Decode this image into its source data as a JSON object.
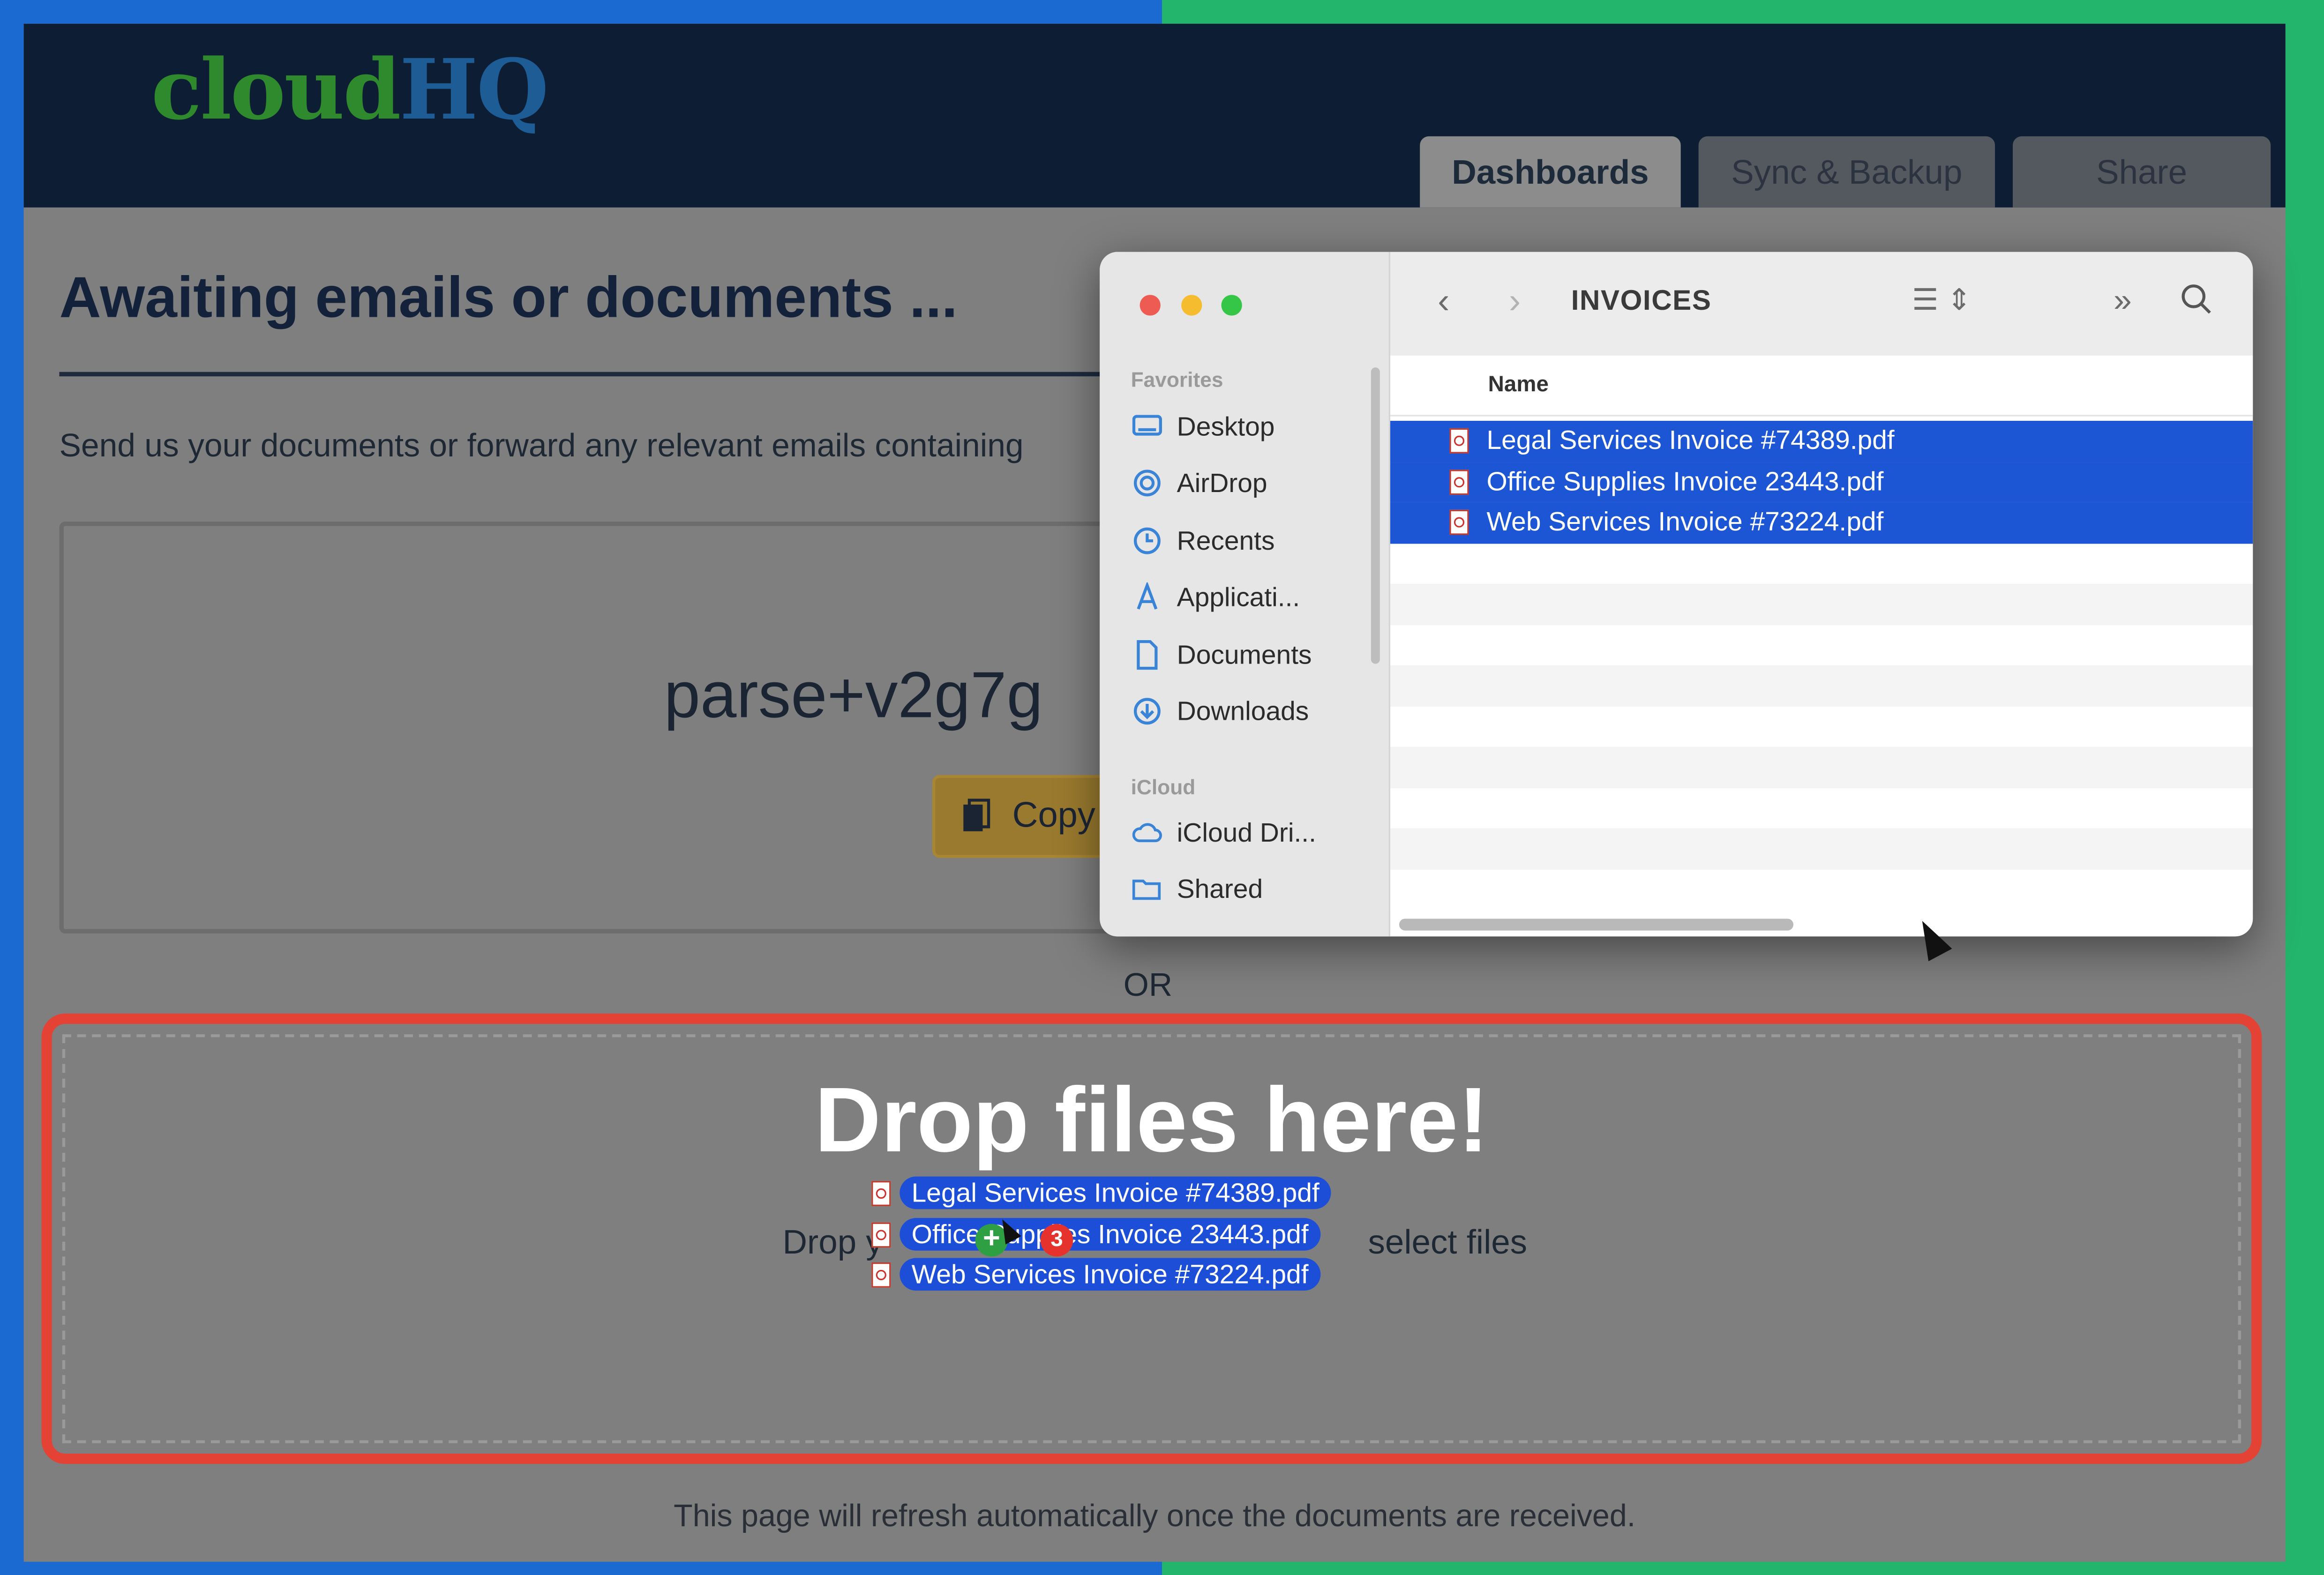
{
  "app": {
    "logo_part1": "cloud",
    "logo_part2": "HQ",
    "tabs": [
      {
        "label": "Dashboards",
        "active": true
      },
      {
        "label": "Sync & Backup",
        "active": false
      },
      {
        "label": "Share",
        "active": false
      }
    ]
  },
  "page": {
    "title": "Awaiting emails or documents ...",
    "intro": "Send us your documents or forward any relevant emails containing",
    "address": "parse+v2g7g",
    "copy_label": "Copy",
    "or_label": "OR",
    "drop_title": "Drop files here!",
    "drop_sub_left": "Drop y",
    "drop_sub_right": "select files",
    "footer": "This page will refresh automatically once the documents are received."
  },
  "drag": {
    "files": [
      "Legal Services Invoice #74389.pdf",
      "Office Supplies Invoice 23443.pdf",
      "Web Services Invoice #73224.pdf"
    ],
    "count_badge": "3",
    "plus_badge": "+"
  },
  "finder": {
    "folder": "INVOICES",
    "column_name": "Name",
    "sections": {
      "favorites": "Favorites",
      "icloud": "iCloud"
    },
    "favorites": [
      {
        "label": "Desktop",
        "icon": "desktop-icon"
      },
      {
        "label": "AirDrop",
        "icon": "airdrop-icon"
      },
      {
        "label": "Recents",
        "icon": "clock-icon"
      },
      {
        "label": "Applicati...",
        "icon": "applications-icon"
      },
      {
        "label": "Documents",
        "icon": "document-icon"
      },
      {
        "label": "Downloads",
        "icon": "download-icon"
      }
    ],
    "icloud": [
      {
        "label": "iCloud Dri...",
        "icon": "cloud-icon"
      },
      {
        "label": "Shared",
        "icon": "shared-folder-icon"
      }
    ],
    "files": [
      {
        "name": "Legal Services Invoice #74389.pdf",
        "selected": true
      },
      {
        "name": "Office Supplies Invoice 23443.pdf",
        "selected": true
      },
      {
        "name": "Web Services Invoice #73224.pdf",
        "selected": true
      }
    ]
  },
  "colors": {
    "selection": "#1c56d4",
    "drop_border": "#e34234",
    "header_bg": "#0d1e34"
  }
}
